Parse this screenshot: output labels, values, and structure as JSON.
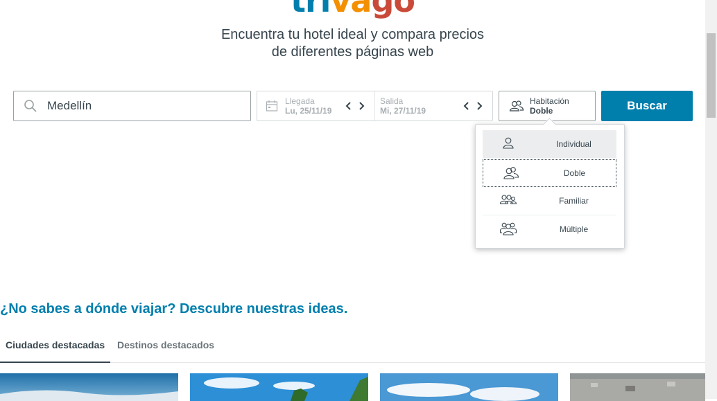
{
  "logo": {
    "part1": "tri",
    "part2": "va",
    "part3": "go"
  },
  "tagline": {
    "line1": "Encuentra tu hotel ideal y compara precios",
    "line2": "de diferentes páginas web"
  },
  "search": {
    "destination_value": "Medellín",
    "icon": "search-icon"
  },
  "dates": {
    "checkin_label": "Llegada",
    "checkin_value": "Lu, 25/11/19",
    "checkout_label": "Salida",
    "checkout_value": "Mi, 27/11/19"
  },
  "room": {
    "label": "Habitación",
    "value": "Doble"
  },
  "search_button": {
    "label": "Buscar",
    "color": "#007fad"
  },
  "room_options": [
    {
      "label": "Individual",
      "icon": "single-person-icon",
      "state": "hover"
    },
    {
      "label": "Doble",
      "icon": "two-people-icon",
      "state": "focused"
    },
    {
      "label": "Familiar",
      "icon": "family-icon",
      "state": "default"
    },
    {
      "label": "Múltiple",
      "icon": "group-icon",
      "state": "default"
    }
  ],
  "ideas": {
    "title": "¿No sabes a dónde viajar? Descubre nuestras ideas."
  },
  "tabs": [
    {
      "label": "Ciudades destacadas",
      "active": true
    },
    {
      "label": "Destinos destacados",
      "active": false
    }
  ],
  "colors": {
    "brand_blue": "#007fad",
    "brand_orange": "#f48f00",
    "brand_red": "#c94a38",
    "text": "#37454d"
  }
}
